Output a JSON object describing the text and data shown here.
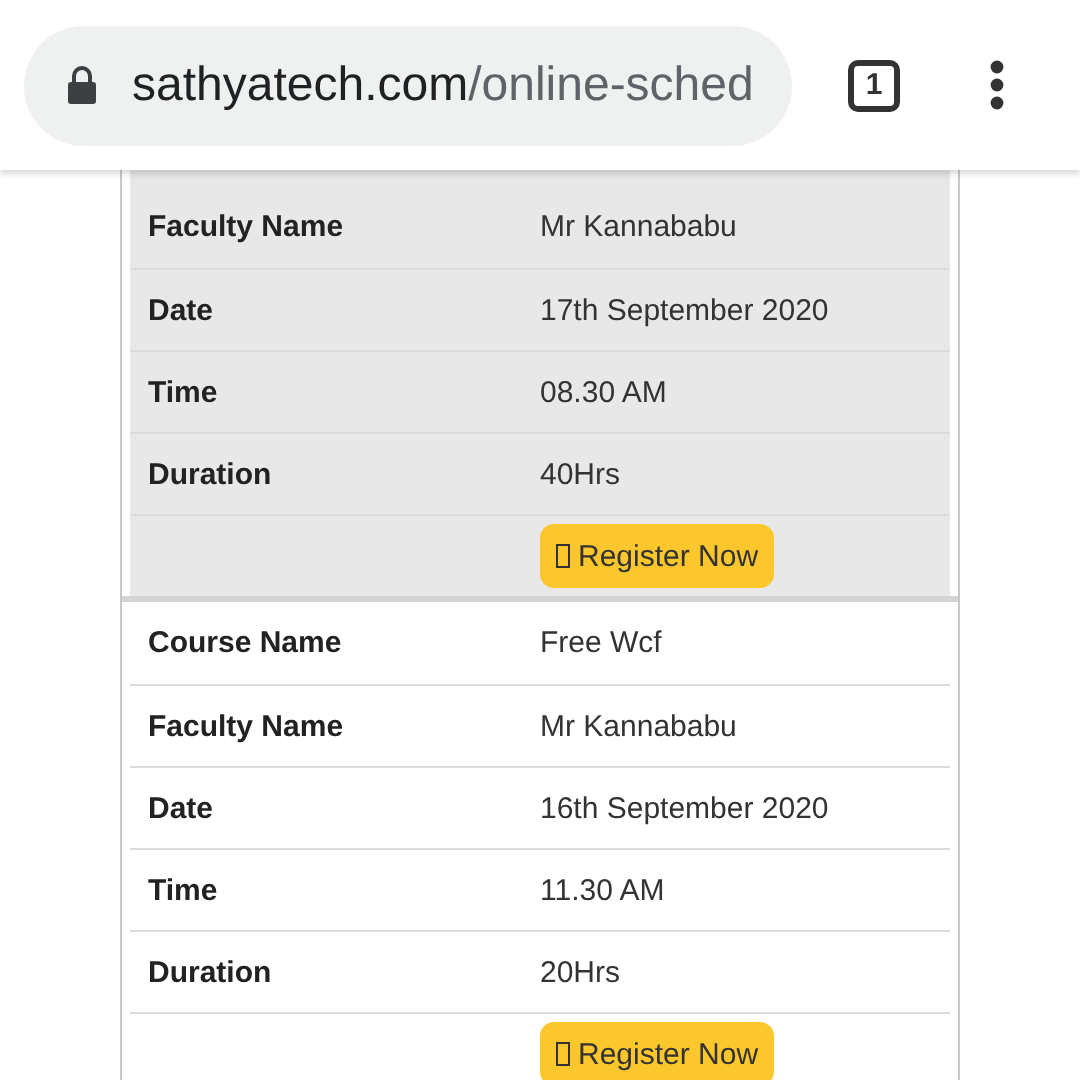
{
  "address_bar": {
    "host": "sathyatech.com",
    "path": "/online-sched",
    "tab_count": "1"
  },
  "schedules": [
    {
      "highlighted": true,
      "rows": [
        {
          "label": "Faculty Name",
          "value": "Mr Kannababu"
        },
        {
          "label": "Date",
          "value": "17th September 2020"
        },
        {
          "label": "Time",
          "value": "08.30 AM"
        },
        {
          "label": "Duration",
          "value": "40Hrs"
        }
      ],
      "button": "Register Now"
    },
    {
      "highlighted": false,
      "rows": [
        {
          "label": "Course Name",
          "value": "Free Wcf"
        },
        {
          "label": "Faculty Name",
          "value": "Mr Kannababu"
        },
        {
          "label": "Date",
          "value": "16th September 2020"
        },
        {
          "label": "Time",
          "value": "11.30 AM"
        },
        {
          "label": "Duration",
          "value": "20Hrs"
        }
      ],
      "button": "Register Now"
    }
  ]
}
